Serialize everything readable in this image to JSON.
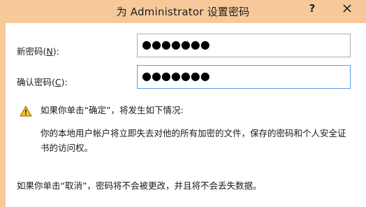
{
  "window": {
    "title": "为 Administrator 设置密码",
    "help_label": "?"
  },
  "form": {
    "new_password_label": "新密码(",
    "new_password_key": "N",
    "new_password_suffix": "):",
    "new_password_value": "●●●●●●●",
    "confirm_password_label": "确认密码(",
    "confirm_password_key": "C",
    "confirm_password_suffix": "):",
    "confirm_password_value": "●●●●●●●"
  },
  "warning": {
    "icon": "warning-triangle-icon",
    "heading": "如果你单击“确定”，将发生如下情况:",
    "body": "你的本地用户帐户将立即失去对他的所有加密的文件，保存的密码和个人安全证书的访问权。",
    "cancel_note": "如果你单击“取消”，密码将不会被更改，并且将不会丢失数据。"
  },
  "colors": {
    "frame": "#f7c99a",
    "focus_border": "#569de5",
    "field_border": "#acacac"
  }
}
